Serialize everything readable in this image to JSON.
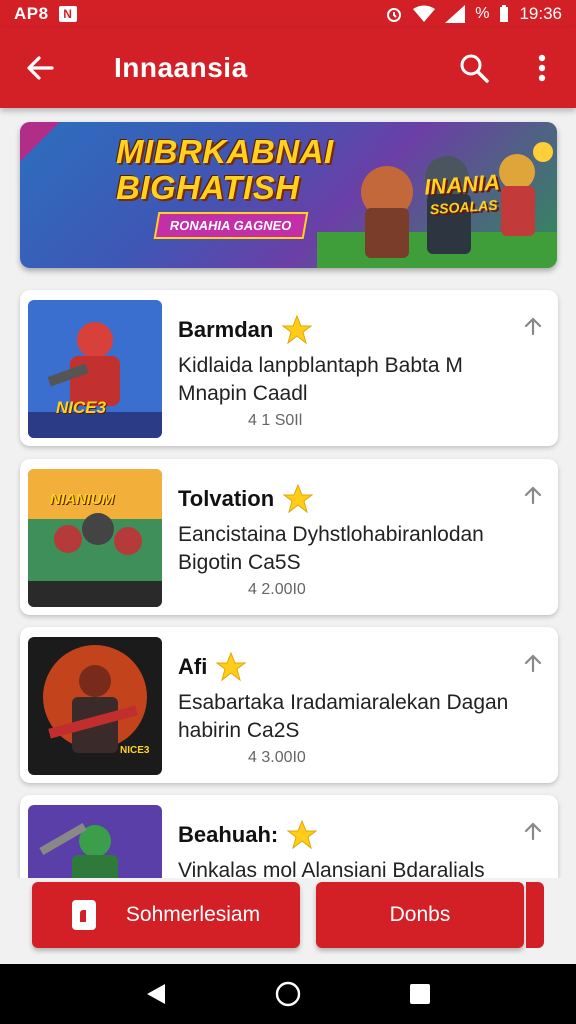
{
  "status_bar": {
    "carrier": "AP8",
    "notification_glyph": "N",
    "battery": "%",
    "time": "19:36"
  },
  "app_bar": {
    "title": "Innaansia",
    "back_icon": "arrow-left-icon",
    "search_icon": "search-icon",
    "more_icon": "more-vert-icon"
  },
  "banner": {
    "title_line1": "MIBRKABNAI",
    "title_line2": "BIGHATISH",
    "subtitle": "RONAHIA GAGNEO",
    "badge_line1": "INANIA",
    "badge_line2": "SSOALAS"
  },
  "items": [
    {
      "name": "Barmdan",
      "description_line1": "Kidlaida lanpblantaph Babta M",
      "description_line2": "Mnapin Caadl",
      "count": "4 1 S0Il",
      "thumb_text": "NICE3"
    },
    {
      "name": "Tolvation",
      "description_line1": "Eancistaina Dyhstlohabiranlodan",
      "description_line2": "Bigotin Ca5S",
      "count": "4 2.00I0",
      "thumb_text": "NIANIUM"
    },
    {
      "name": "Afi",
      "description_line1": "Esabartaka Iradamiaralekan Dagan",
      "description_line2": "habirin Ca2S",
      "count": "4 3.00I0",
      "thumb_text": "NICE3"
    },
    {
      "name": "Beahuah:",
      "description_line1": "Vinkalas mol Alansiani Bdaralials",
      "description_line2": "",
      "count": "",
      "thumb_text": ""
    }
  ],
  "actions": {
    "left_label": "Sohmerlesiam",
    "right_label": "Donbs"
  },
  "nav": {
    "back": "nav-back-icon",
    "home": "nav-home-icon",
    "recents": "nav-recents-icon"
  },
  "colors": {
    "primary": "#d32027",
    "star": "#ffcc1a"
  }
}
